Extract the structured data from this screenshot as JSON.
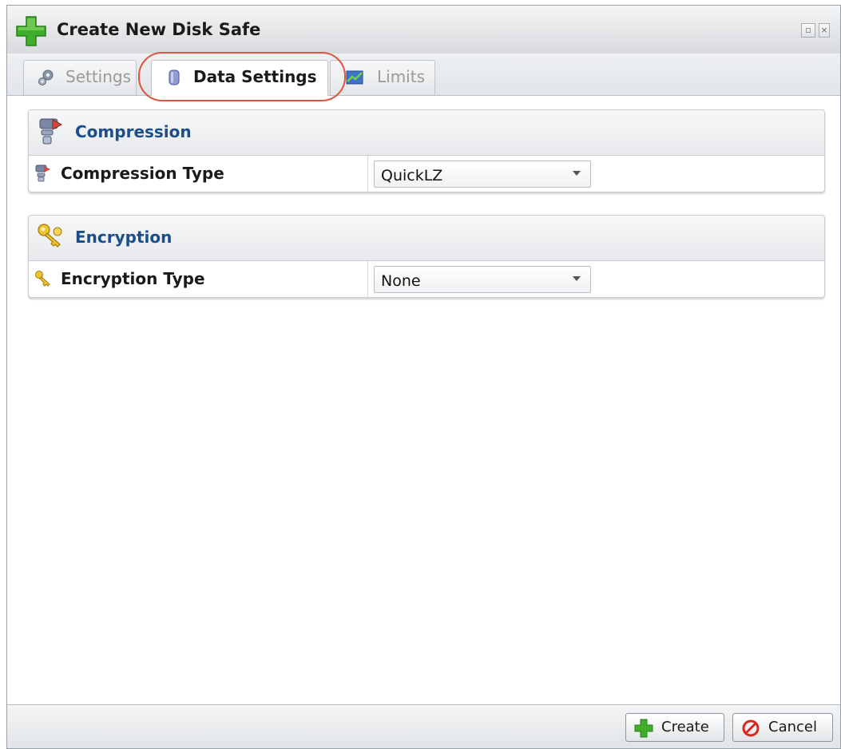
{
  "window": {
    "title": "Create New Disk Safe"
  },
  "tabs": [
    {
      "label": "Settings",
      "active": false
    },
    {
      "label": "Data Settings",
      "active": true
    },
    {
      "label": "Limits",
      "active": false
    }
  ],
  "panels": {
    "compression": {
      "title": "Compression",
      "row_label": "Compression Type",
      "value": "QuickLZ"
    },
    "encryption": {
      "title": "Encryption",
      "row_label": "Encryption Type",
      "value": "None"
    }
  },
  "footer": {
    "create_label": "Create",
    "cancel_label": "Cancel"
  },
  "colors": {
    "highlight": "#e0543f",
    "panel_title": "#1b4f8c",
    "plus_green": "#3fae2a"
  }
}
